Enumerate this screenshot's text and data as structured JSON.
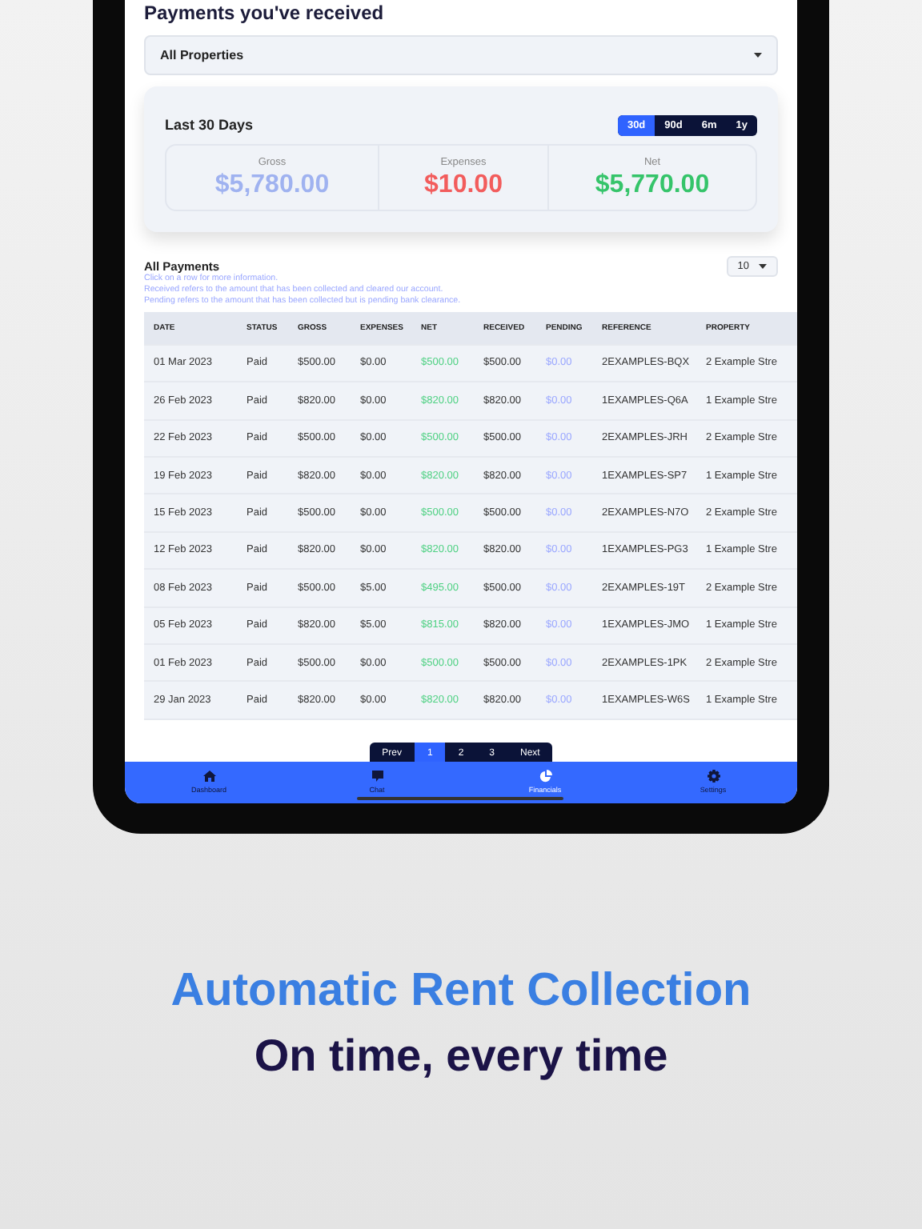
{
  "page_title": "Payments you've received",
  "property_filter": {
    "value": "All Properties"
  },
  "summary": {
    "title": "Last 30 Days",
    "ranges": [
      {
        "label": "30d",
        "selected": true
      },
      {
        "label": "90d",
        "selected": false
      },
      {
        "label": "6m",
        "selected": false
      },
      {
        "label": "1y",
        "selected": false
      }
    ],
    "stats": [
      {
        "label": "Gross",
        "value": "$5,780.00",
        "color": "#9fb2f0"
      },
      {
        "label": "Expenses",
        "value": "$10.00",
        "color": "#f25c5c"
      },
      {
        "label": "Net",
        "value": "$5,770.00",
        "color": "#35c46a"
      }
    ]
  },
  "payments": {
    "title": "All Payments",
    "page_size": "10",
    "notes": [
      "Click on a row for more information.",
      "Received refers to the amount that has been collected and cleared our account.",
      "Pending refers to the amount that has been collected but is pending bank clearance."
    ],
    "columns": [
      "DATE",
      "STATUS",
      "GROSS",
      "EXPENSES",
      "NET",
      "RECEIVED",
      "PENDING",
      "REFERENCE",
      "PROPERTY"
    ],
    "rows": [
      [
        "01 Mar 2023",
        "Paid",
        "$500.00",
        "$0.00",
        "$500.00",
        "$500.00",
        "$0.00",
        "2EXAMPLES-BQX",
        "2 Example Stre"
      ],
      [
        "26 Feb 2023",
        "Paid",
        "$820.00",
        "$0.00",
        "$820.00",
        "$820.00",
        "$0.00",
        "1EXAMPLES-Q6A",
        "1 Example Stre"
      ],
      [
        "22 Feb 2023",
        "Paid",
        "$500.00",
        "$0.00",
        "$500.00",
        "$500.00",
        "$0.00",
        "2EXAMPLES-JRH",
        "2 Example Stre"
      ],
      [
        "19 Feb 2023",
        "Paid",
        "$820.00",
        "$0.00",
        "$820.00",
        "$820.00",
        "$0.00",
        "1EXAMPLES-SP7",
        "1 Example Stre"
      ],
      [
        "15 Feb 2023",
        "Paid",
        "$500.00",
        "$0.00",
        "$500.00",
        "$500.00",
        "$0.00",
        "2EXAMPLES-N7O",
        "2 Example Stre"
      ],
      [
        "12 Feb 2023",
        "Paid",
        "$820.00",
        "$0.00",
        "$820.00",
        "$820.00",
        "$0.00",
        "1EXAMPLES-PG3",
        "1 Example Stre"
      ],
      [
        "08 Feb 2023",
        "Paid",
        "$500.00",
        "$5.00",
        "$495.00",
        "$500.00",
        "$0.00",
        "2EXAMPLES-19T",
        "2 Example Stre"
      ],
      [
        "05 Feb 2023",
        "Paid",
        "$820.00",
        "$5.00",
        "$815.00",
        "$820.00",
        "$0.00",
        "1EXAMPLES-JMO",
        "1 Example Stre"
      ],
      [
        "01 Feb 2023",
        "Paid",
        "$500.00",
        "$0.00",
        "$500.00",
        "$500.00",
        "$0.00",
        "2EXAMPLES-1PK",
        "2 Example Stre"
      ],
      [
        "29 Jan 2023",
        "Paid",
        "$820.00",
        "$0.00",
        "$820.00",
        "$820.00",
        "$0.00",
        "1EXAMPLES-W6S",
        "1 Example Stre"
      ]
    ]
  },
  "pagination": [
    {
      "label": "Prev",
      "selected": false
    },
    {
      "label": "1",
      "selected": true
    },
    {
      "label": "2",
      "selected": false
    },
    {
      "label": "3",
      "selected": false
    },
    {
      "label": "Next",
      "selected": false
    }
  ],
  "tab_bar": [
    {
      "label": "Dashboard",
      "kind": "home",
      "selected": false
    },
    {
      "label": "Chat",
      "kind": "chat",
      "selected": false
    },
    {
      "label": "Financials",
      "kind": "pie",
      "selected": true
    },
    {
      "label": "Settings",
      "kind": "gear",
      "selected": false
    }
  ],
  "headline": "Automatic Rent Collection",
  "tagline": "On time, every time"
}
